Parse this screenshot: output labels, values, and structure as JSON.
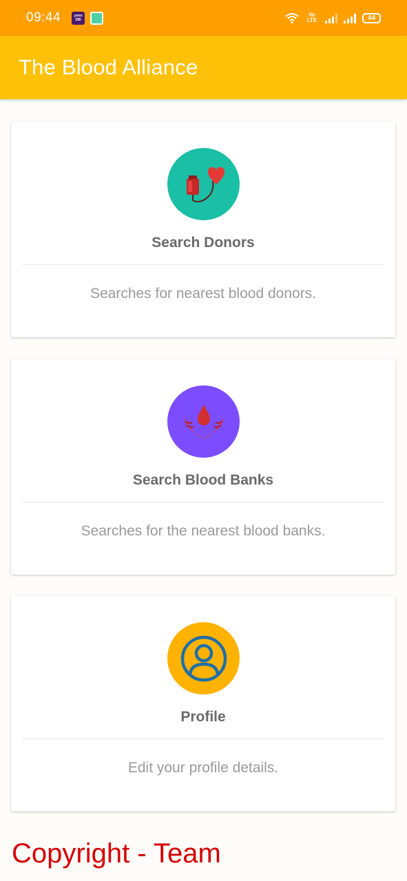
{
  "status_bar": {
    "time": "09:44",
    "notif_yono": "yono SBI",
    "volte": "Vo LTE",
    "battery": "44"
  },
  "app_bar": {
    "title": "The Blood Alliance"
  },
  "cards": [
    {
      "title": "Search Donors",
      "description": "Searches for nearest blood donors.",
      "icon": "blood-bag-heart-icon",
      "icon_bg": "#1bbfa5"
    },
    {
      "title": "Search Blood Banks",
      "description": "Searches for the nearest blood banks.",
      "icon": "blood-drop-hands-icon",
      "icon_bg": "#7c4dff"
    },
    {
      "title": "Profile",
      "description": "Edit your profile details.",
      "icon": "user-profile-icon",
      "icon_bg": "#ffb300"
    }
  ],
  "footer": {
    "text": "Copyright - Team"
  },
  "colors": {
    "status_bar": "#ff9f00",
    "app_bar": "#ffc107",
    "footer_text": "#d50000"
  }
}
